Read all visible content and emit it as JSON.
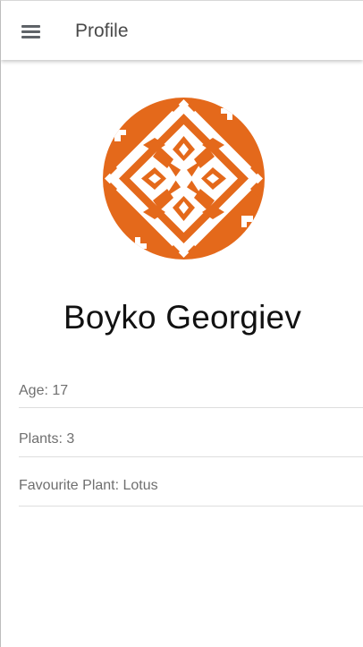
{
  "header": {
    "title": "Profile",
    "menu_icon": "menu-icon"
  },
  "profile": {
    "avatar_icon": "geometric-pattern-avatar",
    "avatar_color": "#e4691b",
    "name": "Boyko Georgiev",
    "details": [
      {
        "text": "Age: 17"
      },
      {
        "text": "Plants: 3"
      },
      {
        "text": "Favourite Plant: Lotus"
      }
    ]
  }
}
